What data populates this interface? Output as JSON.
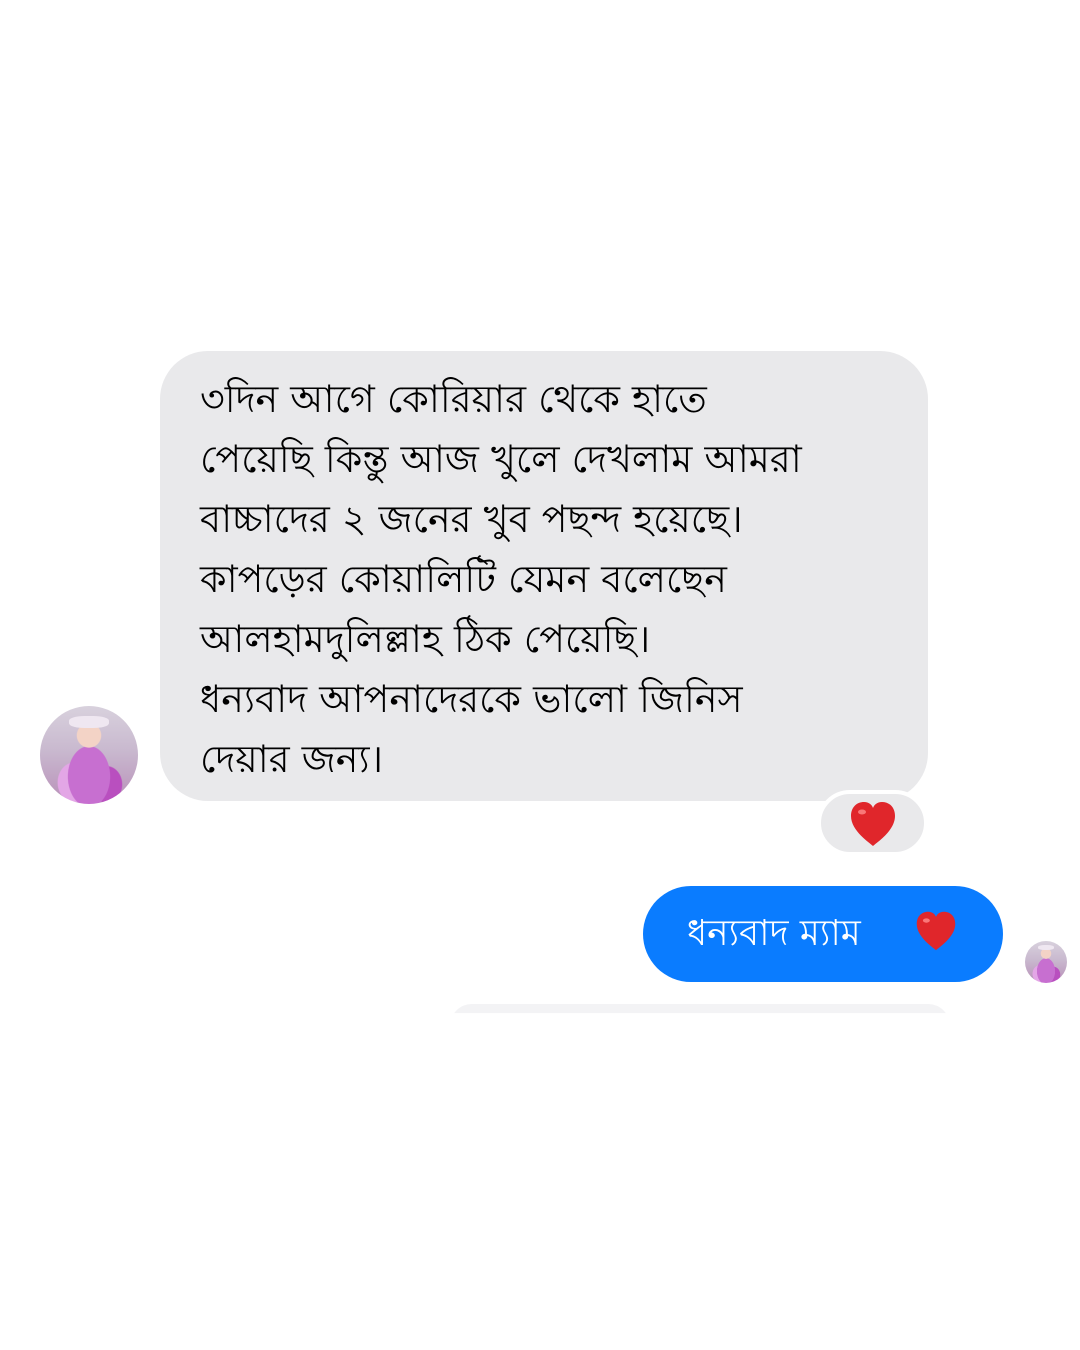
{
  "conversation": {
    "incoming_message": {
      "lines": [
        "৩দিন আগে কোরিয়ার থেকে হাতে",
        "পেয়েছি কিন্তু আজ খুলে দেখলাম আমরা",
        "বাচ্চাদের  ২ জনের খুব পছন্দ হয়েছে।",
        "কাপড়ের কোয়ালিটি যেমন বলেছেন",
        "আলহামদুলিল্লাহ ঠিক পেয়েছি।",
        "ধন্যবাদ আপনাদেরকে ভালো জিনিস",
        "দেয়ার জন্য।"
      ],
      "reaction": "heart-icon"
    },
    "outgoing_message": {
      "text": "ধন্যবাদ ম্যাম",
      "emoji": "heart-icon"
    }
  },
  "colors": {
    "incoming_bubble": "#e9e9eb",
    "outgoing_bubble": "#0a7cff",
    "heart": "#e0262b",
    "background": "#ffffff"
  }
}
